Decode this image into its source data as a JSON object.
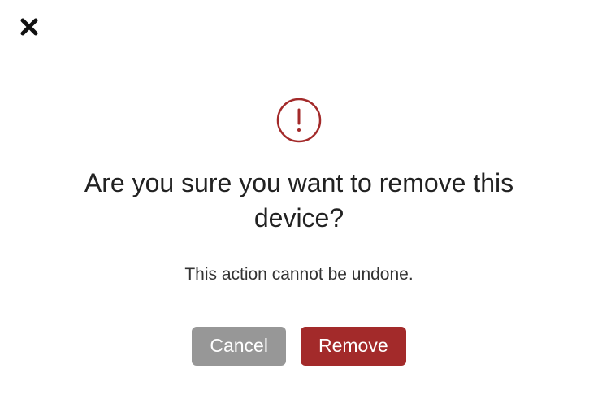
{
  "dialog": {
    "title": "Are you sure you want to remove this device?",
    "subtitle": "This action cannot be undone.",
    "cancel_label": "Cancel",
    "confirm_label": "Remove"
  },
  "colors": {
    "danger": "#a32a2a",
    "neutral": "#979797"
  }
}
